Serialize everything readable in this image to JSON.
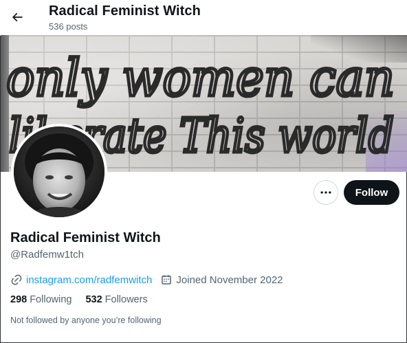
{
  "header": {
    "title": "Radical Feminist Witch",
    "post_count": "536 posts"
  },
  "banner": {
    "graffiti_line1": "only women can",
    "graffiti_line2": "liberate This world"
  },
  "actions": {
    "follow_label": "Follow"
  },
  "profile": {
    "name": "Radical Feminist Witch",
    "handle": "@Radfemw1tch",
    "website": "instagram.com/radfemwitch",
    "joined": "Joined November 2022"
  },
  "stats": {
    "following_count": "298",
    "following_label": "Following",
    "followers_count": "532",
    "followers_label": "Followers"
  },
  "social_context": "Not followed by anyone you’re following",
  "colors": {
    "link": "#1d9bf0",
    "text_primary": "#0f1419",
    "text_secondary": "#536471",
    "button_dark": "#0f1419"
  },
  "icons": [
    "back-arrow-icon",
    "more-icon",
    "link-icon",
    "calendar-icon"
  ]
}
